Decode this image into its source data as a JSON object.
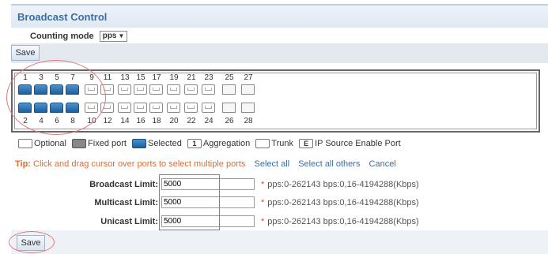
{
  "page": {
    "title": "Broadcast Control"
  },
  "counting_mode": {
    "label": "Counting mode",
    "selected": "pps"
  },
  "buttons": {
    "save_top": "Save",
    "save_bottom": "Save"
  },
  "ports": {
    "top_numbers": [
      "1",
      "3",
      "5",
      "7",
      "9",
      "11",
      "13",
      "15",
      "17",
      "19",
      "21",
      "23",
      "25",
      "27"
    ],
    "bottom_numbers": [
      "2",
      "4",
      "6",
      "8",
      "10",
      "12",
      "14",
      "16",
      "18",
      "20",
      "22",
      "24",
      "26",
      "28"
    ],
    "selected_ports": [
      1,
      2,
      3,
      4,
      5,
      6,
      7,
      8
    ]
  },
  "legend": {
    "optional": "Optional",
    "fixed": "Fixed port",
    "selected": "Selected",
    "aggregation_icon": "1",
    "aggregation": "Aggregation",
    "trunk": "Trunk",
    "ip_source_icon": "E",
    "ip_source": "IP Source Enable Port"
  },
  "tip": {
    "label": "Tip:",
    "text": "Click and drag cursor over ports to select multiple ports",
    "select_all": "Select all",
    "select_all_others": "Select all others",
    "cancel": "Cancel"
  },
  "limits": {
    "broadcast": {
      "label": "Broadcast Limit:",
      "value": "5000"
    },
    "multicast": {
      "label": "Multicast Limit:",
      "value": "5000"
    },
    "unicast": {
      "label": "Unicast Limit:",
      "value": "5000"
    },
    "hint": "pps:0-262143 bps:0,16-4194288(Kbps)",
    "required_mark": "*"
  },
  "colors": {
    "title": "#3a6ea5",
    "tip": "#e06b2e",
    "link": "#3a6ea5",
    "selected_port": "#1e5f9e",
    "annotation": "#e07a7a"
  }
}
